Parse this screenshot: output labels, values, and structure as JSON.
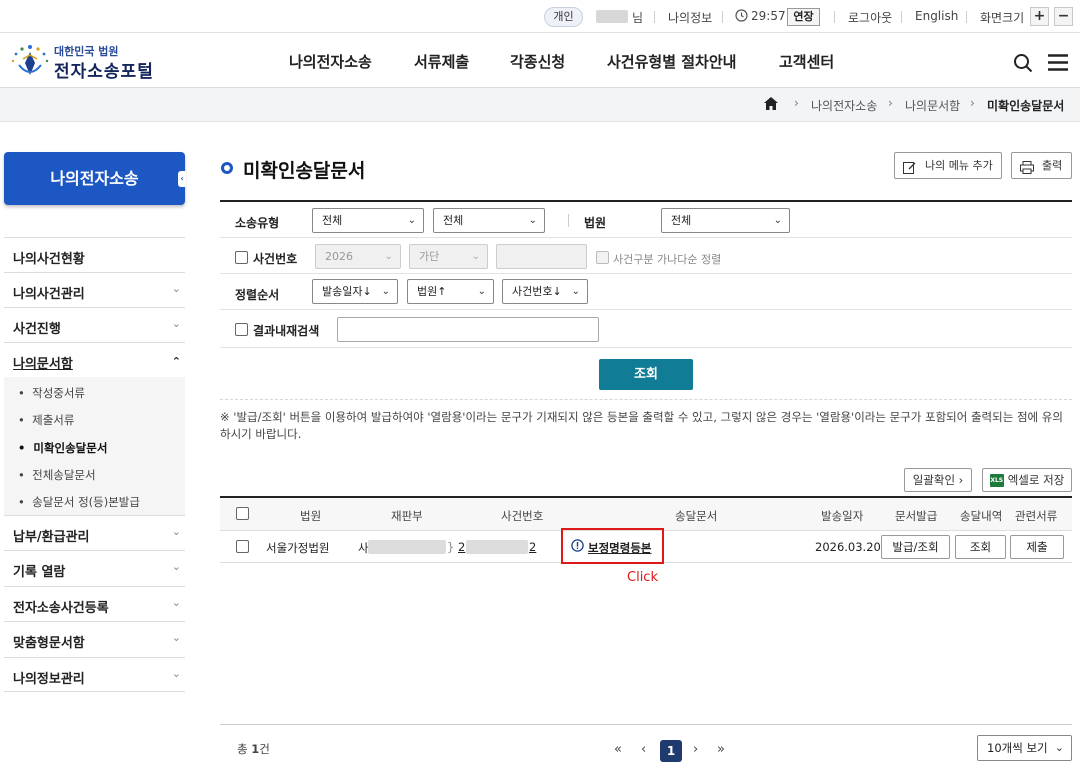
{
  "topbar": {
    "badge": "개인",
    "name_suffix": "님",
    "my_info": "나의정보",
    "timer": "29:57",
    "extend": "연장",
    "logout": "로그아웃",
    "language": "English",
    "font_size": "화면크기",
    "zoom_in": "+",
    "zoom_out": "−"
  },
  "header": {
    "logo_sub": "대한민국 법원",
    "logo_main": "전자소송포털",
    "gnb": [
      "나의전자소송",
      "서류제출",
      "각종신청",
      "사건유형별 절차안내",
      "고객센터"
    ]
  },
  "breadcrumb": [
    "나의전자소송",
    "나의문서함",
    "미확인송달문서"
  ],
  "sidebar": {
    "title": "나의전자소송",
    "items": [
      {
        "label": "나의사건현황"
      },
      {
        "label": "나의사건관리"
      },
      {
        "label": "사건진행"
      },
      {
        "label": "나의문서함"
      },
      {
        "label": "납부/환급관리"
      },
      {
        "label": "기록 열람"
      },
      {
        "label": "전자소송사건등록"
      },
      {
        "label": "맞춤형문서함"
      },
      {
        "label": "나의정보관리"
      }
    ],
    "subitems": [
      "작성중서류",
      "제출서류",
      "미확인송달문서",
      "전체송달문서",
      "송달문서 정(등)본발급"
    ]
  },
  "page": {
    "title": "미확인송달문서",
    "add_menu": "나의 메뉴 추가",
    "print": "출력"
  },
  "search": {
    "type_label": "소송유형",
    "type_value1": "전체",
    "type_value2": "전체",
    "court_label": "법원",
    "court_value": "전체",
    "case_label": "사건번호",
    "year_value": "2026",
    "case_kind_value": "가단",
    "sort_option_label": "사건구분 가나다순 정렬",
    "order_label": "정렬순서",
    "order1": "발송일자↓",
    "order2": "법원↑",
    "order3": "사건번호↓",
    "within_label": "결과내재검색",
    "submit": "조회"
  },
  "notice": "※ '발급/조회' 버튼을 이용하여 발급하여야 '열람용'이라는 문구가 기재되지 않은 등본을 출력할 수 있고, 그렇지 않은 경우는 '열람용'이라는 문구가 포함되어 출력되는 점에 유의하시기 바랍니다.",
  "actions": {
    "bulk_confirm": "일괄확인",
    "excel": "엑셀로 저장",
    "excel_icon_text": "XLS"
  },
  "grid": {
    "headers": [
      "법원",
      "재판부",
      "사건번호",
      "송달문서",
      "발송일자",
      "문서발급",
      "송달내역",
      "관련서류"
    ],
    "rows": [
      {
        "court": "서울가정법원",
        "division_prefix": "사",
        "division_suffix": "}",
        "case_prefix": "2",
        "case_suffix": "2",
        "document": "보정명령등본",
        "date": "2026.03.20",
        "issue": "발급/조회",
        "history": "조회",
        "related": "제출"
      }
    ]
  },
  "annotation": {
    "click": "Click"
  },
  "footer": {
    "total_prefix": "총",
    "total_count": "1",
    "total_suffix": "건",
    "current_page": "1",
    "page_size": "10개씩 보기"
  },
  "colors": {
    "primary_blue": "#1c57c4",
    "search_button": "#117c96",
    "highlight_red": "#e01818",
    "page_active": "#1e3a6e"
  }
}
